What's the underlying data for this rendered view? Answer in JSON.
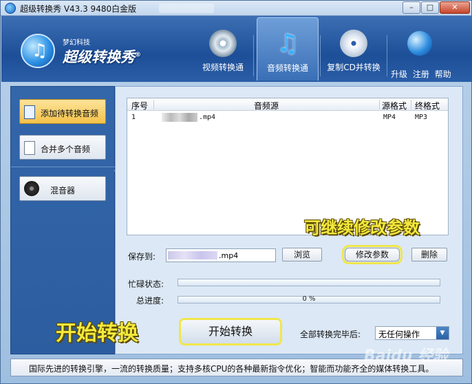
{
  "window": {
    "title": "超级转换秀 V43.3 9480白金版",
    "min_label": "–",
    "max_label": "□",
    "close_label": "✕"
  },
  "brand": {
    "small": "梦幻科技",
    "name": "超级转换秀",
    "reg": "®"
  },
  "tabs": [
    {
      "label": "视频转换通",
      "icon": "film-reel-icon"
    },
    {
      "label": "音频转换通",
      "icon": "music-note-icon",
      "active": true
    },
    {
      "label": "复制CD并转换",
      "icon": "cd-disc-icon"
    }
  ],
  "top_links": {
    "upgrade": "升级",
    "register": "注册",
    "help": "帮助"
  },
  "sidebar": {
    "items": [
      {
        "label": "添加待转换音频",
        "icon": "music-file-icon",
        "active": true
      },
      {
        "label": "合并多个音频",
        "icon": "document-icon"
      },
      {
        "label": "混音器",
        "icon": "speaker-icon"
      }
    ]
  },
  "file_list": {
    "columns": [
      "序号",
      "音频源",
      "源格式",
      "终格式"
    ],
    "rows": [
      {
        "index": "1",
        "source_suffix": ".mp4",
        "src_format": "MP4",
        "dst_format": "MP3"
      }
    ]
  },
  "save": {
    "label": "保存到:",
    "value_suffix": ".mp4",
    "browse": "浏览",
    "modify": "修改参数",
    "delete": "删除"
  },
  "progress": {
    "busy_label": "忙碌状态:",
    "total_label": "总进度:",
    "total_value": 0,
    "total_text": "0 %"
  },
  "actions": {
    "start": "开始转换",
    "after_label": "全部转换完毕后:",
    "after_value": "无任何操作"
  },
  "annotations": {
    "modify_note": "可继续修改参数",
    "start_note": "开始转换"
  },
  "statusbar": {
    "text": "国际先进的转换引擎，一流的转换质量；支持多核CPU的各种最新指令优化；智能而功能齐全的媒体转换工具。"
  },
  "watermark": "Baidu 经验",
  "colors": {
    "header": "#2a5ea7",
    "active_item": "#f4c24a",
    "highlight": "#f3ea3c"
  }
}
